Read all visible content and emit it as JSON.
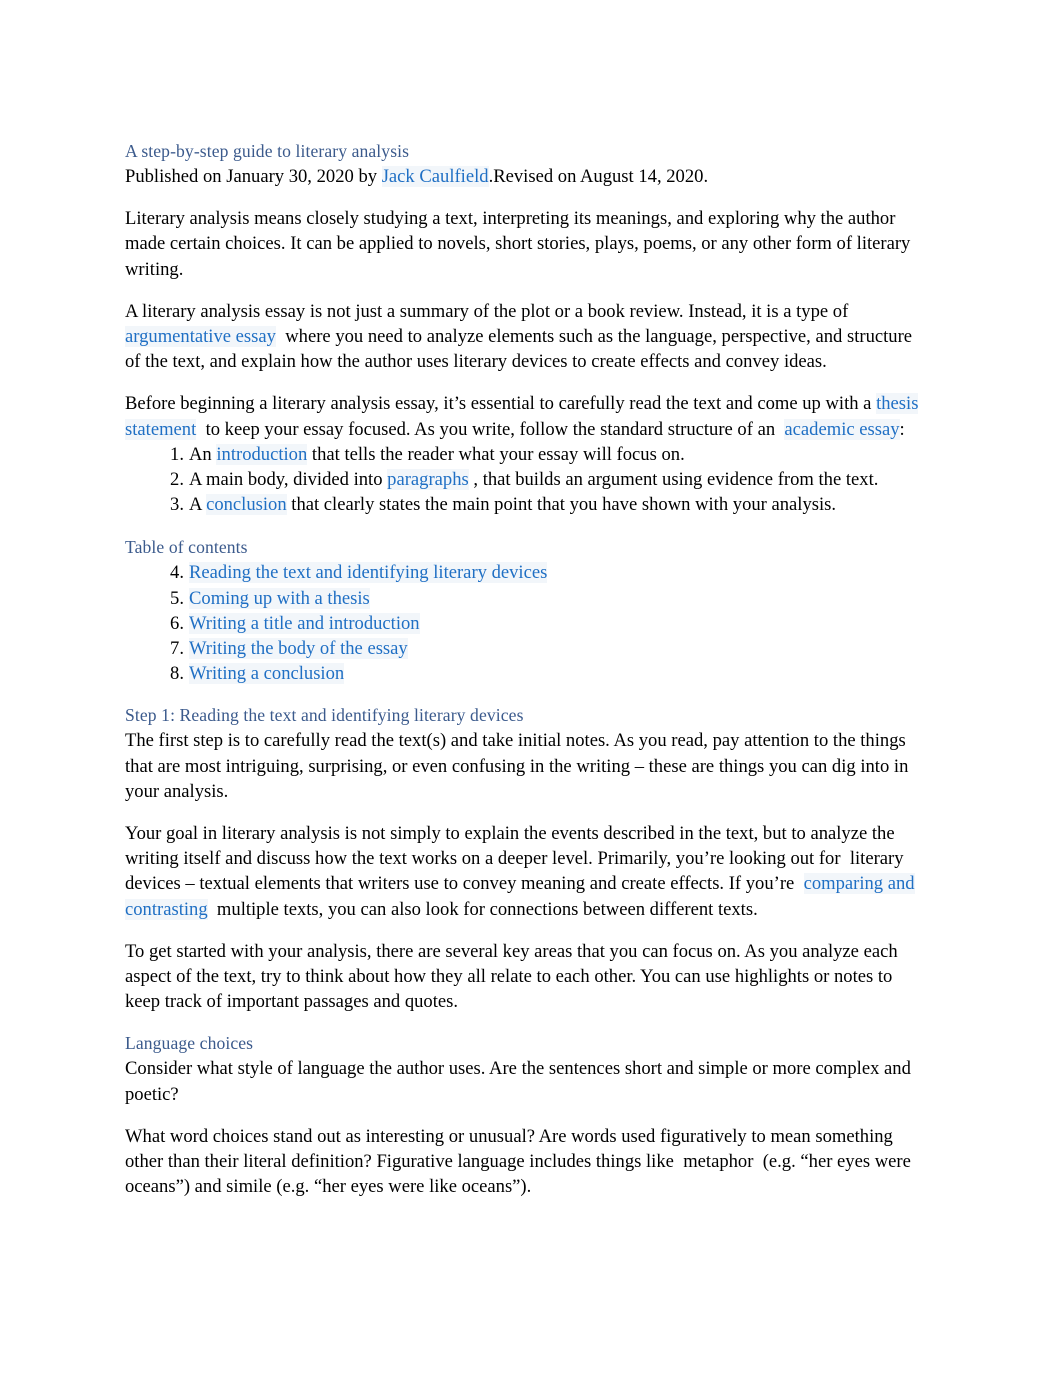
{
  "document": {
    "title": "A step-by-step guide to literary analysis",
    "byline": {
      "published_prefix": "Published on January 30, 2020 by ",
      "author": "Jack Caulfield",
      "revised": ".Revised on August 14, 2020."
    },
    "intro_paragraphs": [
      "Literary analysis means closely studying a text, interpreting its meanings, and exploring why the author made certain choices. It can be applied to novels, short stories, plays, poems, or any other form of literary writing."
    ],
    "paragraph_argumentative": {
      "part1": "A literary analysis essay is not just a summary of the plot or a book review. Instead, it is a type of ",
      "link": "argumentative essay",
      "part2": " where you need to analyze elements such as the language, perspective, and structure of the text, and explain how the author uses literary devices to create effects and convey ideas."
    },
    "paragraph_thesis": {
      "part1": "Before beginning a literary analysis essay, it’s essential to carefully read the text and come up with a ",
      "link1": "thesis statement",
      "part2": " to keep your essay focused. As you write, follow the standard structure of an ",
      "link2": "academic essay",
      "part3": ":"
    },
    "structure_list": [
      {
        "number": "1.",
        "before": "An ",
        "link": "introduction",
        "after": " that tells the reader what your essay will focus on."
      },
      {
        "number": "2.",
        "before": "A main body, divided into ",
        "link": "paragraphs",
        "after": ", that builds an argument using evidence from the text."
      },
      {
        "number": "3.",
        "before": "A ",
        "link": "conclusion",
        "after": " that clearly states the main point that you have shown with your analysis."
      }
    ],
    "table_of_contents": {
      "heading": "Table of contents",
      "items": [
        {
          "number": "4.",
          "label": "Reading the text and identifying literary devices"
        },
        {
          "number": "5.",
          "label": "Coming up with a thesis"
        },
        {
          "number": "6.",
          "label": "Writing a title and introduction"
        },
        {
          "number": "7.",
          "label": "Writing the body of the essay"
        },
        {
          "number": "8.",
          "label": "Writing a conclusion"
        }
      ]
    },
    "step1": {
      "heading": "Step 1: Reading the text and identifying literary devices",
      "paragraph1": "The first step is to carefully read the text(s) and take initial notes. As you read, pay attention to the things that are most intriguing, surprising, or even confusing in the writing – these are things you can dig into in your analysis.",
      "paragraph2": {
        "part1": "Your goal in literary analysis is not simply to explain the events described in the text, but to analyze the writing itself and discuss how the text works on a deeper level. Primarily, you’re looking out for ",
        "emphasis": "literary devices",
        "part2": " – textual elements that writers use to convey meaning and create effects. If you’re ",
        "link": "comparing and contrasting",
        "part3": " multiple texts, you can also look for connections between different texts."
      },
      "paragraph3": "To get started with your analysis, there are several key areas that you can focus on. As you analyze each aspect of the text, try to think about how they all relate to each other. You can use highlights or notes to keep track of important passages and quotes."
    },
    "language_choices": {
      "heading": "Language choices",
      "paragraph1": "Consider what style of language the author uses. Are the sentences short and simple or more complex and poetic?",
      "paragraph2": {
        "part1": "What word choices stand out as interesting or unusual? Are words used figuratively to mean something other than their literal definition? Figurative language includes things like ",
        "emphasis": "metaphor",
        "part2": " (e.g. “her eyes were oceans”) and simile (e.g. “her eyes were like oceans”)."
      }
    }
  },
  "colors": {
    "heading": "#3b5a8c",
    "link": "#1f6fc4",
    "link_highlight": "#f2f6fa",
    "text": "#000000",
    "background": "#ffffff"
  }
}
